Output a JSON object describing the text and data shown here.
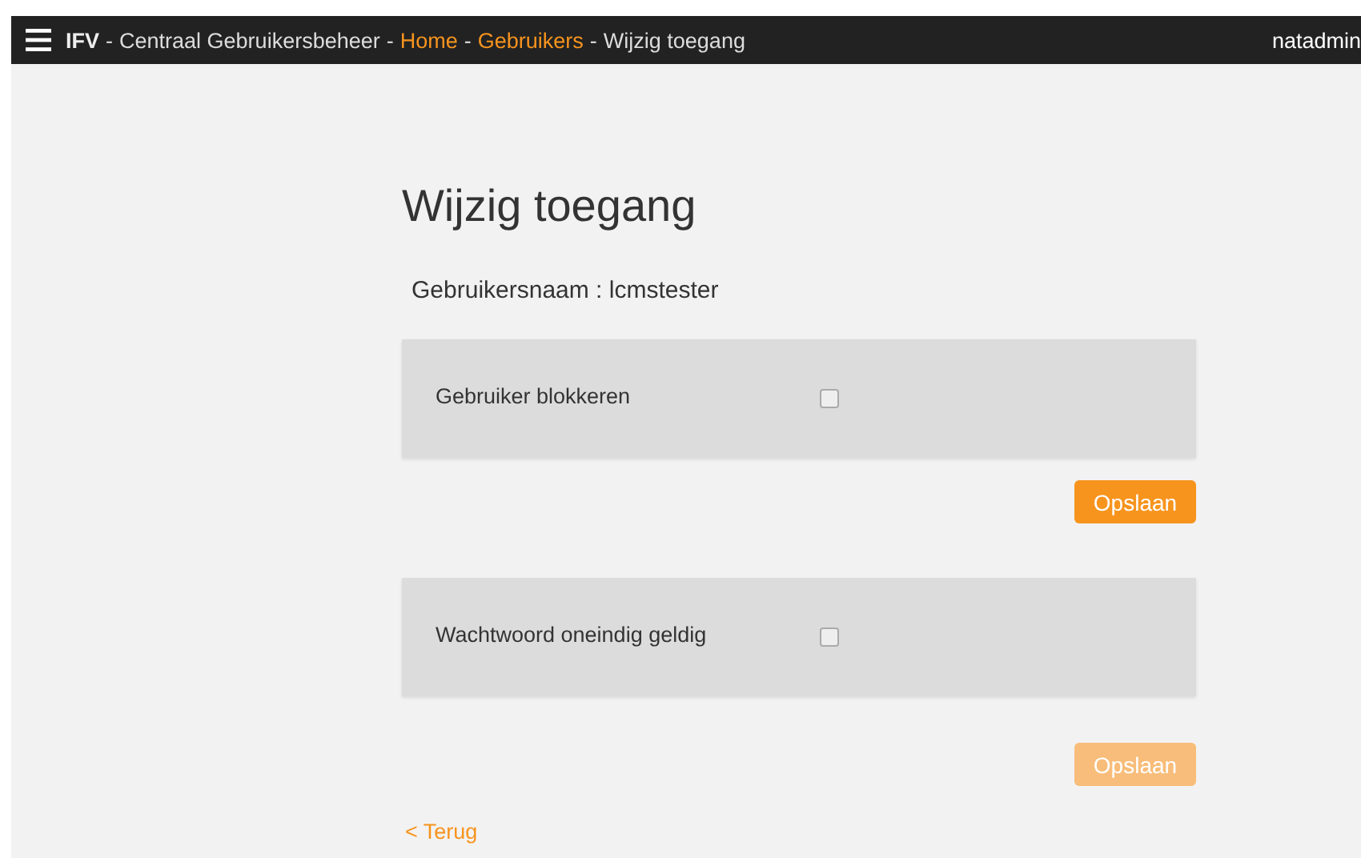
{
  "navbar": {
    "brand": "IFV",
    "separator": "-",
    "breadcrumbs": [
      {
        "label": "Centraal Gebruikersbeheer",
        "kind": "text"
      },
      {
        "label": "Home",
        "kind": "link"
      },
      {
        "label": "Gebruikers",
        "kind": "link"
      },
      {
        "label": "Wijzig toegang",
        "kind": "text"
      }
    ],
    "user": "natadmin"
  },
  "title": "Wijzig toegang",
  "username": {
    "label": "Gebruikersnaam",
    "separator": ":",
    "value": "lcmstester"
  },
  "sections": [
    {
      "label": "Gebruiker blokkeren",
      "checked": false,
      "button": {
        "label": "Opslaan",
        "disabled": false
      }
    },
    {
      "label": "Wachtwoord oneindig geldig",
      "checked": false,
      "button": {
        "label": "Opslaan",
        "disabled": true
      }
    }
  ],
  "back_link": "< Terug"
}
